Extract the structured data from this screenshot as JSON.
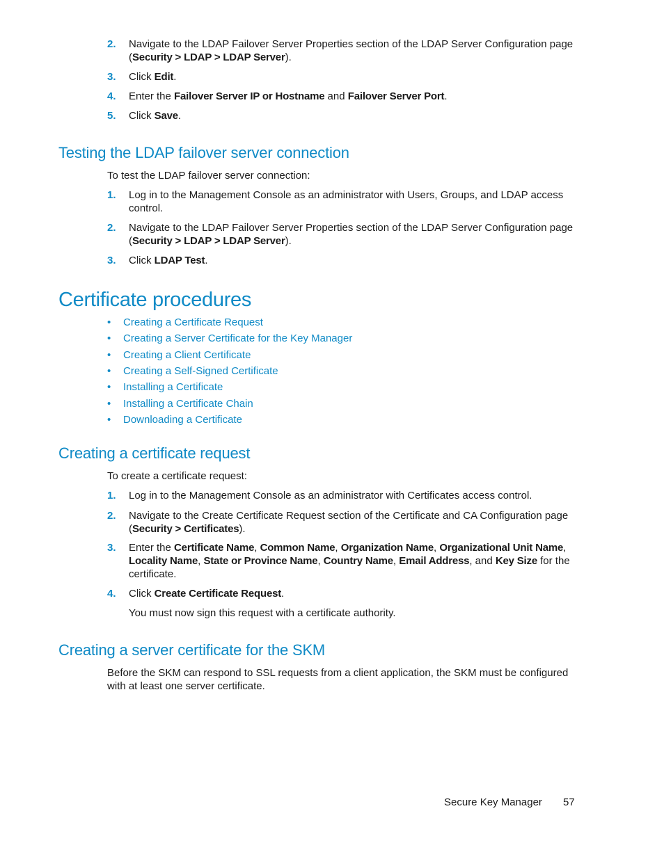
{
  "colors": {
    "accent": "#0f8ac6",
    "text": "#1a1a1a"
  },
  "top_steps": [
    {
      "num": "2.",
      "parts": [
        {
          "t": "Navigate to the LDAP Failover Server Properties section of the LDAP Server Configuration page ("
        },
        {
          "t": "Security > LDAP > LDAP Server",
          "b": true
        },
        {
          "t": ")."
        }
      ]
    },
    {
      "num": "3.",
      "parts": [
        {
          "t": "Click "
        },
        {
          "t": "Edit",
          "b": true
        },
        {
          "t": "."
        }
      ]
    },
    {
      "num": "4.",
      "parts": [
        {
          "t": "Enter the "
        },
        {
          "t": "Failover Server IP or Hostname",
          "b": true
        },
        {
          "t": " and "
        },
        {
          "t": "Failover Server Port",
          "b": true
        },
        {
          "t": "."
        }
      ]
    },
    {
      "num": "5.",
      "parts": [
        {
          "t": "Click "
        },
        {
          "t": "Save",
          "b": true
        },
        {
          "t": "."
        }
      ]
    }
  ],
  "testing": {
    "heading": "Testing the LDAP failover server connection",
    "intro": "To test the LDAP failover server connection:",
    "steps": [
      {
        "num": "1.",
        "parts": [
          {
            "t": "Log in to the Management Console as an administrator with Users, Groups, and LDAP access control."
          }
        ]
      },
      {
        "num": "2.",
        "parts": [
          {
            "t": "Navigate to the LDAP Failover Server Properties section of the LDAP Server Configuration page ("
          },
          {
            "t": "Security > LDAP > LDAP Server",
            "b": true
          },
          {
            "t": ")."
          }
        ]
      },
      {
        "num": "3.",
        "parts": [
          {
            "t": "Click "
          },
          {
            "t": "LDAP Test",
            "b": true
          },
          {
            "t": "."
          }
        ]
      }
    ]
  },
  "cert_procedures": {
    "heading": "Certificate procedures",
    "bullet": "•",
    "links": [
      "Creating a Certificate Request",
      "Creating a Server Certificate for the Key Manager",
      "Creating a Client Certificate",
      "Creating a Self-Signed Certificate",
      "Installing a Certificate",
      "Installing a Certificate Chain",
      "Downloading a Certificate"
    ]
  },
  "cert_request": {
    "heading": "Creating a certificate request",
    "intro": "To create a certificate request:",
    "steps": [
      {
        "num": "1.",
        "parts": [
          {
            "t": "Log in to the Management Console as an administrator with Certificates access control."
          }
        ]
      },
      {
        "num": "2.",
        "parts": [
          {
            "t": "Navigate to the Create Certificate Request section of the Certificate and CA Configuration page ("
          },
          {
            "t": "Security > Certificates",
            "b": true
          },
          {
            "t": ")."
          }
        ]
      },
      {
        "num": "3.",
        "parts": [
          {
            "t": "Enter the "
          },
          {
            "t": "Certificate Name",
            "b": true
          },
          {
            "t": ", "
          },
          {
            "t": "Common Name",
            "b": true
          },
          {
            "t": ", "
          },
          {
            "t": "Organization Name",
            "b": true
          },
          {
            "t": ", "
          },
          {
            "t": "Organizational Unit Name",
            "b": true
          },
          {
            "t": ", "
          },
          {
            "t": "Locality Name",
            "b": true
          },
          {
            "t": ", "
          },
          {
            "t": "State or Province Name",
            "b": true
          },
          {
            "t": ", "
          },
          {
            "t": "Country Name",
            "b": true
          },
          {
            "t": ", "
          },
          {
            "t": "Email Address",
            "b": true
          },
          {
            "t": ", and "
          },
          {
            "t": "Key Size",
            "b": true
          },
          {
            "t": " for the certificate."
          }
        ]
      },
      {
        "num": "4.",
        "parts": [
          {
            "t": "Click "
          },
          {
            "t": "Create Certificate Request",
            "b": true
          },
          {
            "t": "."
          }
        ]
      }
    ],
    "note": "You must now sign this request with a certificate authority."
  },
  "server_cert": {
    "heading": "Creating a server certificate for the SKM",
    "body": "Before the SKM can respond to SSL requests from a client application, the SKM must be configured with at least one server certificate."
  },
  "footer": {
    "title": "Secure Key Manager",
    "page_number": "57"
  }
}
